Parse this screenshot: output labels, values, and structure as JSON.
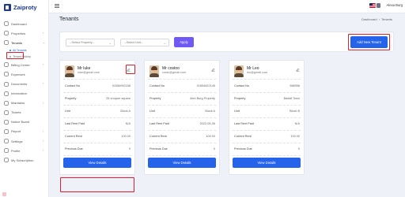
{
  "app": {
    "name": "Zaiproty"
  },
  "sidebar": {
    "items": [
      {
        "label": "Dashboard",
        "icon": "grid-icon"
      },
      {
        "label": "Properties",
        "icon": "building-icon",
        "chevron": true
      },
      {
        "label": "Tenants",
        "icon": "users-icon",
        "chevron": true,
        "open": true
      },
      {
        "label": "Billing Center",
        "icon": "bill-icon",
        "chevron": true
      },
      {
        "label": "Expenses",
        "icon": "wallet-icon"
      },
      {
        "label": "Documents",
        "icon": "file-icon",
        "chevron": true
      },
      {
        "label": "Information",
        "icon": "info-icon"
      },
      {
        "label": "Maintains",
        "icon": "tool-icon",
        "chevron": true
      },
      {
        "label": "Tickets",
        "icon": "ticket-icon"
      },
      {
        "label": "Notice Board",
        "icon": "clipboard-icon"
      },
      {
        "label": "Report",
        "icon": "chart-icon",
        "chevron": true
      },
      {
        "label": "Settings",
        "icon": "gear-icon",
        "chevron": true
      },
      {
        "label": "Profile",
        "icon": "user-icon",
        "chevron": true
      },
      {
        "label": "My Subscription",
        "icon": "card-icon"
      }
    ],
    "tenant_sub": [
      {
        "label": "All Tenants",
        "active": true
      },
      {
        "label": "Tenant History",
        "active": false
      }
    ]
  },
  "topbar": {
    "user": "Alexa Burg"
  },
  "header": {
    "title": "Tenants",
    "breadcrumb": [
      "Dashboard",
      "Tenants"
    ]
  },
  "filters": {
    "property_placeholder": "--Select Property--",
    "unit_placeholder": "--Select Unit--",
    "apply_label": "Apply",
    "add_label": "Add New Tenant"
  },
  "labels": {
    "contact": "Contact No",
    "property": "Property",
    "unit": "Unit",
    "last_rent": "Last Rent Paid",
    "current_rent": "Current Rent",
    "previous_due": "Previous Due",
    "status": "Status",
    "view": "View Details"
  },
  "tenants": [
    {
      "name": "Mr luke",
      "email": "luke@gmail.com",
      "contact": "01556932158",
      "property": "25 croquer square",
      "unit": "Block A",
      "last_rent": "N/A",
      "current_rent": "100.00",
      "previous_due": "0",
      "status": "Active"
    },
    {
      "name": "Mr costoo",
      "email": "costo@gmail.com",
      "contact": "01854622145",
      "property": "Alex Burg Property",
      "unit": "Block A",
      "last_rent": "2022-05-06",
      "current_rent": "100.00",
      "previous_due": "0",
      "status": "Active"
    },
    {
      "name": "Mr Leo",
      "email": "leo@gmail.com",
      "contact": "568956",
      "property": "Badall Town",
      "unit": "Block B",
      "last_rent": "N/A",
      "current_rent": "100.00",
      "previous_due": "0",
      "status": "Active"
    }
  ],
  "colors": {
    "primary": "#2563eb",
    "apply": "#6e59f5",
    "highlight": "#e11d2e",
    "active_badge": "#16a34a"
  }
}
